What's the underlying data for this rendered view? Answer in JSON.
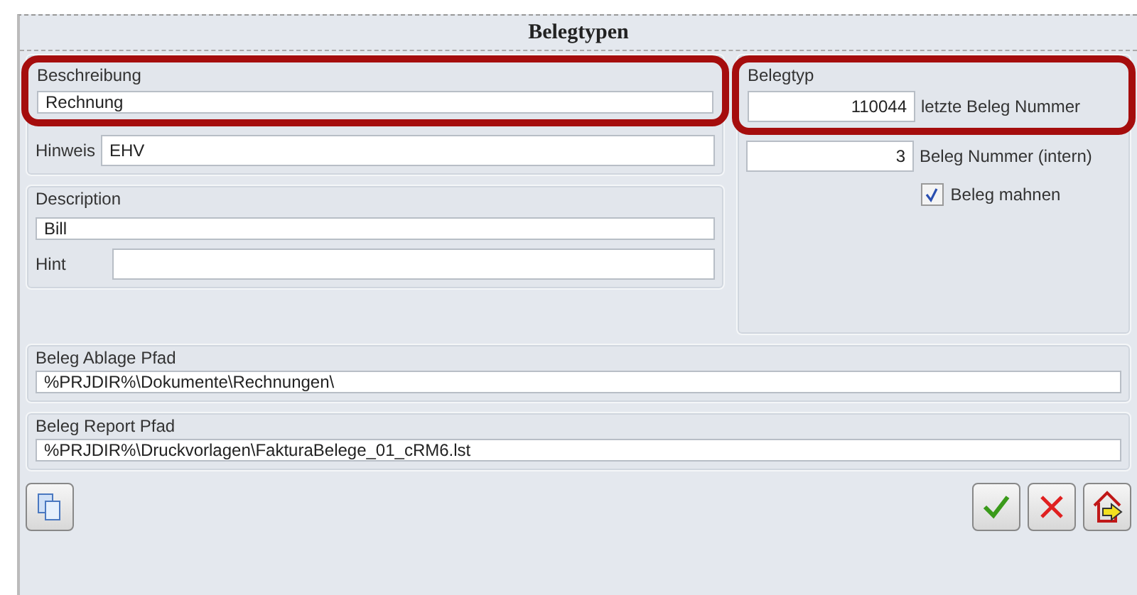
{
  "window": {
    "title": "Belegtypen"
  },
  "beschreibung": {
    "label": "Beschreibung",
    "value": "Rechnung",
    "highlighted": true,
    "hint_label": "Hinweis",
    "hint_value": "EHV"
  },
  "description": {
    "label": "Description",
    "value": "Bill",
    "hint_label": "Hint"
  },
  "belegtyp": {
    "label": "Belegtyp",
    "highlighted": true,
    "last_number": {
      "value": "110044",
      "label": "letzte Beleg Nummer"
    },
    "internal_number": {
      "value": "3",
      "label": "Beleg Nummer (intern)"
    },
    "remind": {
      "label": "Beleg mahnen",
      "checked": true
    }
  },
  "paths": [
    {
      "label": "Beleg Ablage Pfad",
      "value": "%PRJDIR%\\Dokumente\\Rechnungen\\"
    },
    {
      "label": "Beleg Report Pfad",
      "value": "%PRJDIR%\\Druckvorlagen\\FakturaBelege_01_cRM6.lst"
    }
  ]
}
